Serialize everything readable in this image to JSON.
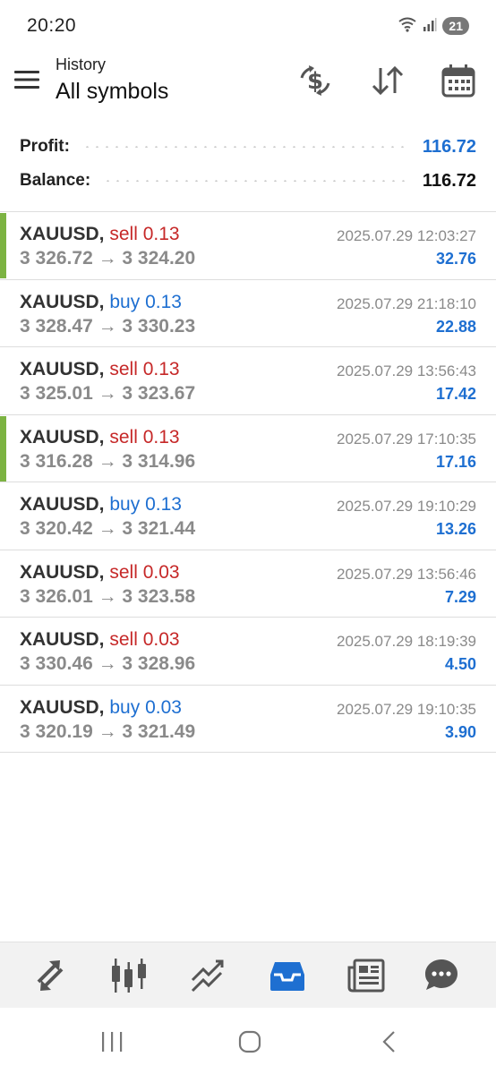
{
  "status_bar": {
    "time": "20:20",
    "battery": "21",
    "icons": [
      "wifi-icon",
      "signal-icon"
    ]
  },
  "header": {
    "subtitle": "History",
    "title": "All symbols",
    "icons": [
      "menu-icon",
      "currency-exchange-icon",
      "sort-icon",
      "calendar-icon"
    ]
  },
  "summary": {
    "profit_label": "Profit:",
    "profit_value": "116.72",
    "balance_label": "Balance:",
    "balance_value": "116.72"
  },
  "deals": [
    {
      "symbol": "XAUUSD,",
      "type": "sell",
      "volume": "0.13",
      "prices": "3 326.72 → 3 324.20",
      "time": "2025.07.29 12:03:27",
      "profit": "32.76",
      "accent": true
    },
    {
      "symbol": "XAUUSD,",
      "type": "buy",
      "volume": "0.13",
      "prices": "3 328.47 → 3 330.23",
      "time": "2025.07.29 21:18:10",
      "profit": "22.88",
      "accent": false
    },
    {
      "symbol": "XAUUSD,",
      "type": "sell",
      "volume": "0.13",
      "prices": "3 325.01 → 3 323.67",
      "time": "2025.07.29 13:56:43",
      "profit": "17.42",
      "accent": false
    },
    {
      "symbol": "XAUUSD,",
      "type": "sell",
      "volume": "0.13",
      "prices": "3 316.28 → 3 314.96",
      "time": "2025.07.29 17:10:35",
      "profit": "17.16",
      "accent": true
    },
    {
      "symbol": "XAUUSD,",
      "type": "buy",
      "volume": "0.13",
      "prices": "3 320.42 → 3 321.44",
      "time": "2025.07.29 19:10:29",
      "profit": "13.26",
      "accent": false
    },
    {
      "symbol": "XAUUSD,",
      "type": "sell",
      "volume": "0.03",
      "prices": "3 326.01 → 3 323.58",
      "time": "2025.07.29 13:56:46",
      "profit": "7.29",
      "accent": false
    },
    {
      "symbol": "XAUUSD,",
      "type": "sell",
      "volume": "0.03",
      "prices": "3 330.46 → 3 328.96",
      "time": "2025.07.29 18:19:39",
      "profit": "4.50",
      "accent": false
    },
    {
      "symbol": "XAUUSD,",
      "type": "buy",
      "volume": "0.03",
      "prices": "3 320.19 → 3 321.49",
      "time": "2025.07.29 19:10:35",
      "profit": "3.90",
      "accent": false
    }
  ],
  "bottom_nav": {
    "items": [
      "quotes-icon",
      "chart-icon",
      "trade-icon",
      "history-icon",
      "news-icon",
      "messages-icon"
    ],
    "active": "history-icon"
  },
  "system_nav": {
    "items": [
      "recents-icon",
      "home-icon",
      "back-icon"
    ]
  },
  "colors": {
    "accent_blue": "#1e6fd1",
    "sell_red": "#c62828",
    "profit_bar_green": "#7cb342",
    "icon_gray": "#555555"
  }
}
